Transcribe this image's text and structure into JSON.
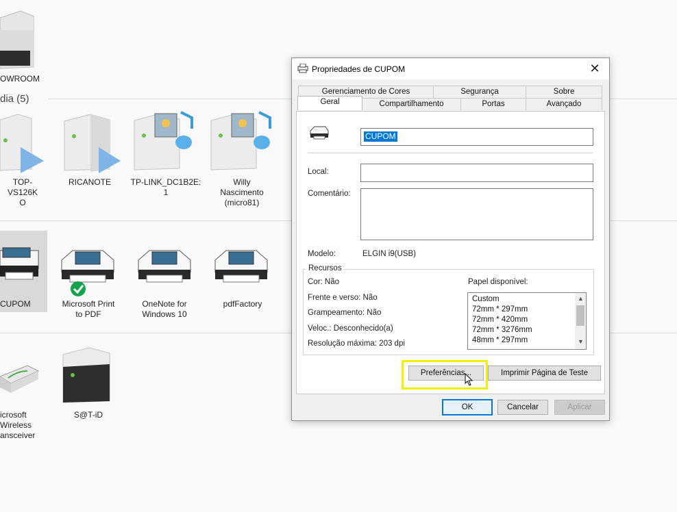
{
  "background": {
    "top_devices": [
      {
        "label": "OWROOM"
      }
    ],
    "group_header": "dia (5)",
    "media_devices": [
      {
        "label_lines": [
          "TOP-VS126K",
          "O"
        ]
      },
      {
        "label_lines": [
          "RICANOTE"
        ]
      },
      {
        "label_lines": [
          "TP-LINK_DC1B2E:",
          "1"
        ]
      },
      {
        "label_lines": [
          "Willy",
          "Nascimento",
          "(micro81)"
        ]
      }
    ],
    "printers": [
      {
        "label_lines": [
          "CUPOM"
        ]
      },
      {
        "label_lines": [
          "Microsoft Print",
          "to PDF"
        ]
      },
      {
        "label_lines": [
          "OneNote for",
          "Windows 10"
        ]
      },
      {
        "label_lines": [
          "pdfFactory"
        ]
      }
    ],
    "other_devices": [
      {
        "label_lines": [
          "icrosoft",
          "Wireless",
          "ansceiver"
        ]
      },
      {
        "label_lines": [
          "S@T-iD"
        ]
      }
    ]
  },
  "dialog": {
    "title": "Propriedades de CUPOM",
    "close_symbol": "✕",
    "tabs_back": [
      "Gerenciamento de Cores",
      "Segurança",
      "Sobre"
    ],
    "tabs_front": [
      "Geral",
      "Compartilhamento",
      "Portas",
      "Avançado"
    ],
    "active_tab": "Geral",
    "printer_name": "CUPOM",
    "local_label": "Local:",
    "local_value": "",
    "comment_label": "Comentário:",
    "comment_value": "",
    "model_label": "Modelo:",
    "model_value": "ELGIN i9(USB)",
    "features": {
      "title": "Recursos",
      "color": "Cor: Não",
      "duplex": "Frente e verso: Não",
      "staple": "Grampeamento: Não",
      "speed": "Veloc.: Desconhecido(a)",
      "resolution": "Resolução máxima: 203 dpi",
      "paper_label": "Papel disponível:",
      "paper_list": [
        "Custom",
        "72mm * 297mm",
        "72mm * 420mm",
        "72mm * 3276mm",
        "48mm * 297mm"
      ]
    },
    "preferences_button": "Preferências...",
    "test_page_button": "Imprimir Página de Teste",
    "ok_button": "OK",
    "cancel_button": "Cancelar",
    "apply_button": "Aplicar"
  },
  "colors": {
    "highlight": "#f5f000",
    "focus_border": "#0078d7",
    "selection": "#0078d7"
  }
}
